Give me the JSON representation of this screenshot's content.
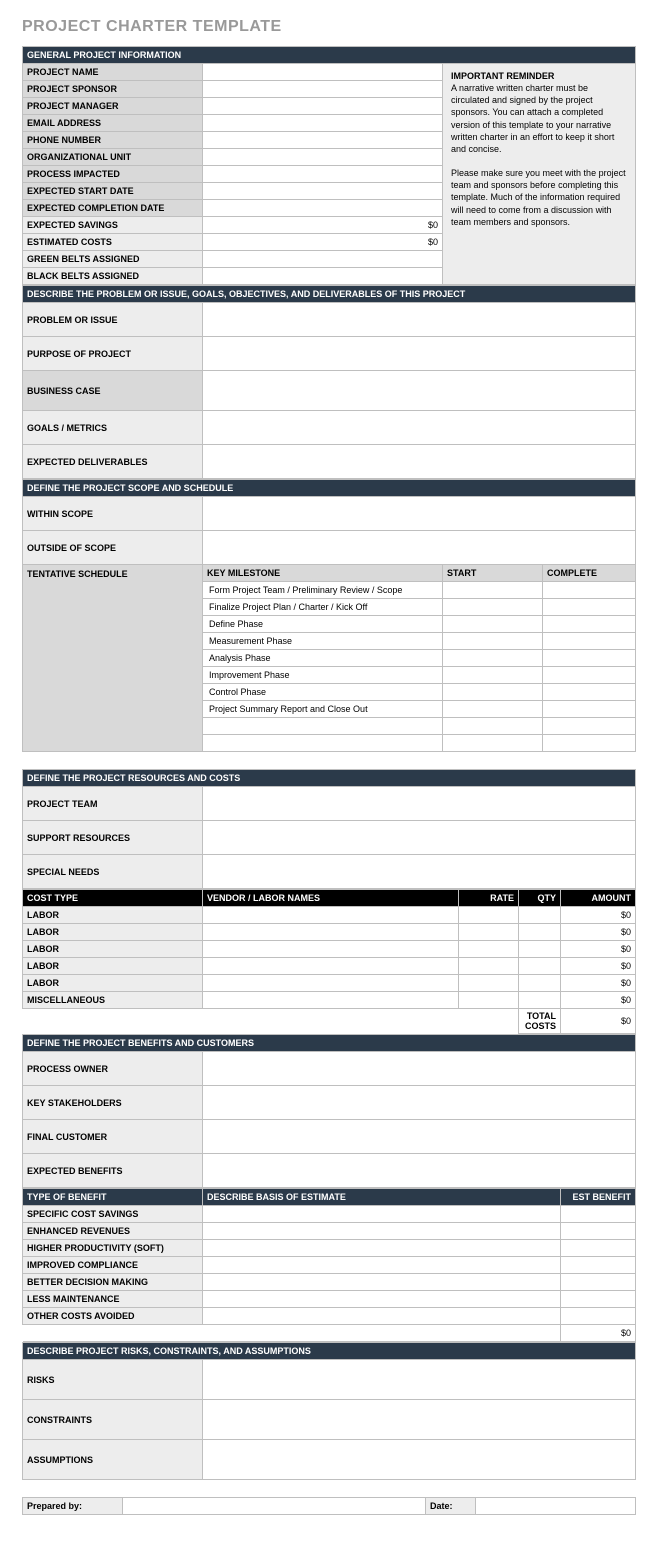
{
  "title": "PROJECT CHARTER TEMPLATE",
  "s1": {
    "hdr": "GENERAL PROJECT INFORMATION",
    "rows": [
      {
        "l": "PROJECT NAME",
        "v": ""
      },
      {
        "l": "PROJECT SPONSOR",
        "v": ""
      },
      {
        "l": "PROJECT MANAGER",
        "v": ""
      },
      {
        "l": "EMAIL ADDRESS",
        "v": ""
      },
      {
        "l": "PHONE NUMBER",
        "v": ""
      },
      {
        "l": "ORGANIZATIONAL UNIT",
        "v": ""
      },
      {
        "l": "PROCESS IMPACTED",
        "v": ""
      },
      {
        "l": "EXPECTED START DATE",
        "v": ""
      },
      {
        "l": "EXPECTED COMPLETION DATE",
        "v": ""
      },
      {
        "l": "EXPECTED SAVINGS",
        "v": "$0"
      },
      {
        "l": "ESTIMATED COSTS",
        "v": "$0"
      },
      {
        "l": "GREEN BELTS ASSIGNED",
        "v": ""
      },
      {
        "l": "BLACK BELTS ASSIGNED",
        "v": ""
      }
    ],
    "rem_h": "IMPORTANT REMINDER",
    "rem_p1": "A narrative written charter must be circulated and signed by the project sponsors. You can attach a completed version of this template to your narrative written charter in an effort to keep it short and concise.",
    "rem_p2": "Please make sure you meet with the project team and sponsors before completing this template. Much of the information required will need to come from a discussion with team members and sponsors."
  },
  "s2": {
    "hdr": "DESCRIBE THE PROBLEM OR ISSUE, GOALS, OBJECTIVES, AND DELIVERABLES OF THIS PROJECT",
    "rows": [
      {
        "l": "PROBLEM OR ISSUE"
      },
      {
        "l": "PURPOSE OF PROJECT"
      },
      {
        "l": "BUSINESS CASE"
      },
      {
        "l": "GOALS / METRICS"
      },
      {
        "l": "EXPECTED DELIVERABLES"
      }
    ]
  },
  "s3": {
    "hdr": "DEFINE THE PROJECT SCOPE AND SCHEDULE",
    "rows": [
      {
        "l": "WITHIN SCOPE"
      },
      {
        "l": "OUTSIDE OF  SCOPE"
      }
    ],
    "ts": "TENTATIVE SCHEDULE",
    "cols": {
      "c1": "KEY MILESTONE",
      "c2": "START",
      "c3": "COMPLETE"
    },
    "ms": [
      "Form Project Team / Preliminary Review / Scope",
      "Finalize Project Plan / Charter / Kick Off",
      "Define Phase",
      "Measurement Phase",
      "Analysis Phase",
      "Improvement Phase",
      "Control Phase",
      "Project Summary Report and Close Out",
      "",
      ""
    ]
  },
  "s4": {
    "hdr": "DEFINE THE PROJECT RESOURCES AND COSTS",
    "rows": [
      {
        "l": "PROJECT TEAM"
      },
      {
        "l": "SUPPORT RESOURCES"
      },
      {
        "l": "SPECIAL NEEDS"
      }
    ]
  },
  "cost": {
    "cols": {
      "c1": "COST TYPE",
      "c2": "VENDOR / LABOR NAMES",
      "c3": "RATE",
      "c4": "QTY",
      "c5": "AMOUNT"
    },
    "rows": [
      {
        "t": "LABOR",
        "a": "$0"
      },
      {
        "t": "LABOR",
        "a": "$0"
      },
      {
        "t": "LABOR",
        "a": "$0"
      },
      {
        "t": "LABOR",
        "a": "$0"
      },
      {
        "t": "LABOR",
        "a": "$0"
      },
      {
        "t": "MISCELLANEOUS",
        "a": "$0"
      }
    ],
    "tot_l": "TOTAL COSTS",
    "tot_v": "$0"
  },
  "s5": {
    "hdr": "DEFINE THE PROJECT BENEFITS AND CUSTOMERS",
    "rows": [
      {
        "l": "PROCESS OWNER"
      },
      {
        "l": "KEY STAKEHOLDERS"
      },
      {
        "l": "FINAL CUSTOMER"
      },
      {
        "l": "EXPECTED BENEFITS"
      }
    ]
  },
  "ben": {
    "cols": {
      "c1": "TYPE OF BENEFIT",
      "c2": "DESCRIBE BASIS OF ESTIMATE",
      "c3": "EST BENEFIT"
    },
    "rows": [
      {
        "t": "SPECIFIC COST SAVINGS"
      },
      {
        "t": "ENHANCED REVENUES"
      },
      {
        "t": "HIGHER PRODUCTIVITY (SOFT)"
      },
      {
        "t": "IMPROVED COMPLIANCE"
      },
      {
        "t": "BETTER DECISION MAKING"
      },
      {
        "t": "LESS MAINTENANCE"
      },
      {
        "t": "OTHER COSTS AVOIDED"
      }
    ],
    "tot": "$0"
  },
  "s6": {
    "hdr": "DESCRIBE PROJECT RISKS, CONSTRAINTS, AND ASSUMPTIONS",
    "rows": [
      {
        "l": "RISKS"
      },
      {
        "l": "CONSTRAINTS"
      },
      {
        "l": "ASSUMPTIONS"
      }
    ]
  },
  "sig": {
    "prep": "Prepared by:",
    "date": "Date:"
  }
}
